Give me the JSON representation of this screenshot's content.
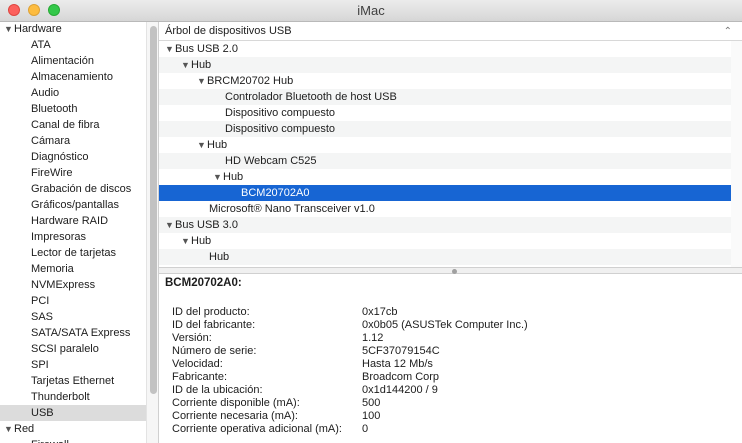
{
  "window": {
    "title": "iMac"
  },
  "sidebar": {
    "groups": [
      {
        "label": "Hardware",
        "items": [
          "ATA",
          "Alimentación",
          "Almacenamiento",
          "Audio",
          "Bluetooth",
          "Canal de fibra",
          "Cámara",
          "Diagnóstico",
          "FireWire",
          "Grabación de discos",
          "Gráficos/pantallas",
          "Hardware RAID",
          "Impresoras",
          "Lector de tarjetas",
          "Memoria",
          "NVMExpress",
          "PCI",
          "SAS",
          "SATA/SATA Express",
          "SCSI paralelo",
          "SPI",
          "Tarjetas Ethernet",
          "Thunderbolt",
          "USB"
        ]
      },
      {
        "label": "Red",
        "items": [
          "Firewall"
        ]
      }
    ],
    "selected": "USB"
  },
  "tree": {
    "header": "Árbol de dispositivos USB",
    "rows": [
      {
        "label": "Bus USB 2.0",
        "disclosure": true
      },
      {
        "label": "Hub",
        "disclosure": true
      },
      {
        "label": "BRCM20702 Hub",
        "disclosure": true
      },
      {
        "label": "Controlador Bluetooth de host USB",
        "disclosure": false
      },
      {
        "label": "Dispositivo compuesto",
        "disclosure": false
      },
      {
        "label": "Dispositivo compuesto",
        "disclosure": false
      },
      {
        "label": "Hub",
        "disclosure": true
      },
      {
        "label": "HD Webcam C525",
        "disclosure": false
      },
      {
        "label": "Hub",
        "disclosure": true
      },
      {
        "label": "BCM20702A0",
        "disclosure": false,
        "selected": true
      },
      {
        "label": "Microsoft® Nano Transceiver v1.0",
        "disclosure": false
      },
      {
        "label": "Bus USB 3.0",
        "disclosure": true
      },
      {
        "label": "Hub",
        "disclosure": true
      },
      {
        "label": "Hub",
        "disclosure": false
      }
    ]
  },
  "detail": {
    "title": "BCM20702A0:",
    "props": [
      {
        "label": "ID del producto:",
        "value": "0x17cb"
      },
      {
        "label": "ID del fabricante:",
        "value": "0x0b05  (ASUSTek Computer Inc.)"
      },
      {
        "label": "Versión:",
        "value": "1.12"
      },
      {
        "label": "Número de serie:",
        "value": "5CF37079154C"
      },
      {
        "label": "Velocidad:",
        "value": "Hasta 12 Mb/s"
      },
      {
        "label": "Fabricante:",
        "value": "Broadcom Corp"
      },
      {
        "label": "ID de la ubicación:",
        "value": "0x1d144200 / 9"
      },
      {
        "label": "Corriente disponible (mA):",
        "value": "500"
      },
      {
        "label": "Corriente necesaria (mA):",
        "value": "100"
      },
      {
        "label": "Corriente operativa adicional (mA):",
        "value": "0"
      }
    ]
  },
  "colors": {
    "selection": "#1765d3",
    "sidebar_selection": "#dcdcdc"
  }
}
